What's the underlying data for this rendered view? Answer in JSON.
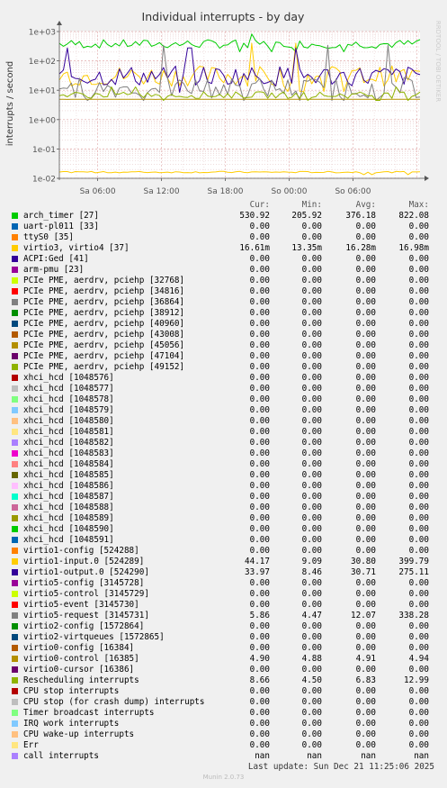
{
  "chart_data": {
    "type": "line",
    "title": "Individual interrupts - by day",
    "ylabel": "interrupts / second",
    "watermark": "RRDTOOL / TOBI OETIKER",
    "yscale": "log",
    "ylim": [
      0.01,
      1000
    ],
    "grid": true,
    "y_ticks": [
      "1e-02",
      "1e-01",
      "1e+00",
      "1e+01",
      "1e+02",
      "1e+03"
    ],
    "x_ticks": [
      "Sa 06:00",
      "Sa 12:00",
      "Sa 18:00",
      "So 00:00",
      "So 06:00"
    ],
    "series": [
      {
        "name": "arch_timer [27]",
        "color": "#00cc00",
        "cur": "530.92",
        "min": "205.92",
        "avg": "376.18",
        "max": "822.08"
      },
      {
        "name": "uart-pl011 [33]",
        "color": "#0066b3",
        "cur": "0.00",
        "min": "0.00",
        "avg": "0.00",
        "max": "0.00"
      },
      {
        "name": "ttyS0 [35]",
        "color": "#ff8000",
        "cur": "0.00",
        "min": "0.00",
        "avg": "0.00",
        "max": "0.00"
      },
      {
        "name": "virtio3, virtio4 [37]",
        "color": "#ffcc00",
        "cur": "16.61m",
        "min": "13.35m",
        "avg": "16.28m",
        "max": "16.98m"
      },
      {
        "name": "ACPI:Ged [41]",
        "color": "#330099",
        "cur": "0.00",
        "min": "0.00",
        "avg": "0.00",
        "max": "0.00"
      },
      {
        "name": "arm-pmu [23]",
        "color": "#990099",
        "cur": "0.00",
        "min": "0.00",
        "avg": "0.00",
        "max": "0.00"
      },
      {
        "name": "PCIe PME, aerdrv, pciehp [32768]",
        "color": "#ccff00",
        "cur": "0.00",
        "min": "0.00",
        "avg": "0.00",
        "max": "0.00"
      },
      {
        "name": "PCIe PME, aerdrv, pciehp [34816]",
        "color": "#ff0000",
        "cur": "0.00",
        "min": "0.00",
        "avg": "0.00",
        "max": "0.00"
      },
      {
        "name": "PCIe PME, aerdrv, pciehp [36864]",
        "color": "#808080",
        "cur": "0.00",
        "min": "0.00",
        "avg": "0.00",
        "max": "0.00"
      },
      {
        "name": "PCIe PME, aerdrv, pciehp [38912]",
        "color": "#008f00",
        "cur": "0.00",
        "min": "0.00",
        "avg": "0.00",
        "max": "0.00"
      },
      {
        "name": "PCIe PME, aerdrv, pciehp [40960]",
        "color": "#00487d",
        "cur": "0.00",
        "min": "0.00",
        "avg": "0.00",
        "max": "0.00"
      },
      {
        "name": "PCIe PME, aerdrv, pciehp [43008]",
        "color": "#b35a00",
        "cur": "0.00",
        "min": "0.00",
        "avg": "0.00",
        "max": "0.00"
      },
      {
        "name": "PCIe PME, aerdrv, pciehp [45056]",
        "color": "#b38f00",
        "cur": "0.00",
        "min": "0.00",
        "avg": "0.00",
        "max": "0.00"
      },
      {
        "name": "PCIe PME, aerdrv, pciehp [47104]",
        "color": "#6b006b",
        "cur": "0.00",
        "min": "0.00",
        "avg": "0.00",
        "max": "0.00"
      },
      {
        "name": "PCIe PME, aerdrv, pciehp [49152]",
        "color": "#8fb300",
        "cur": "0.00",
        "min": "0.00",
        "avg": "0.00",
        "max": "0.00"
      },
      {
        "name": "xhci_hcd [1048576]",
        "color": "#b30000",
        "cur": "0.00",
        "min": "0.00",
        "avg": "0.00",
        "max": "0.00"
      },
      {
        "name": "xhci_hcd [1048577]",
        "color": "#bebebe",
        "cur": "0.00",
        "min": "0.00",
        "avg": "0.00",
        "max": "0.00"
      },
      {
        "name": "xhci_hcd [1048578]",
        "color": "#80ff80",
        "cur": "0.00",
        "min": "0.00",
        "avg": "0.00",
        "max": "0.00"
      },
      {
        "name": "xhci_hcd [1048579]",
        "color": "#80c9ff",
        "cur": "0.00",
        "min": "0.00",
        "avg": "0.00",
        "max": "0.00"
      },
      {
        "name": "xhci_hcd [1048580]",
        "color": "#ffc080",
        "cur": "0.00",
        "min": "0.00",
        "avg": "0.00",
        "max": "0.00"
      },
      {
        "name": "xhci_hcd [1048581]",
        "color": "#ffe680",
        "cur": "0.00",
        "min": "0.00",
        "avg": "0.00",
        "max": "0.00"
      },
      {
        "name": "xhci_hcd [1048582]",
        "color": "#aa80ff",
        "cur": "0.00",
        "min": "0.00",
        "avg": "0.00",
        "max": "0.00"
      },
      {
        "name": "xhci_hcd [1048583]",
        "color": "#ee00cc",
        "cur": "0.00",
        "min": "0.00",
        "avg": "0.00",
        "max": "0.00"
      },
      {
        "name": "xhci_hcd [1048584]",
        "color": "#ff8080",
        "cur": "0.00",
        "min": "0.00",
        "avg": "0.00",
        "max": "0.00"
      },
      {
        "name": "xhci_hcd [1048585]",
        "color": "#666600",
        "cur": "0.00",
        "min": "0.00",
        "avg": "0.00",
        "max": "0.00"
      },
      {
        "name": "xhci_hcd [1048586]",
        "color": "#ffbfff",
        "cur": "0.00",
        "min": "0.00",
        "avg": "0.00",
        "max": "0.00"
      },
      {
        "name": "xhci_hcd [1048587]",
        "color": "#00ffcc",
        "cur": "0.00",
        "min": "0.00",
        "avg": "0.00",
        "max": "0.00"
      },
      {
        "name": "xhci_hcd [1048588]",
        "color": "#cc6699",
        "cur": "0.00",
        "min": "0.00",
        "avg": "0.00",
        "max": "0.00"
      },
      {
        "name": "xhci_hcd [1048589]",
        "color": "#999900",
        "cur": "0.00",
        "min": "0.00",
        "avg": "0.00",
        "max": "0.00"
      },
      {
        "name": "xhci_hcd [1048590]",
        "color": "#00cc00",
        "cur": "0.00",
        "min": "0.00",
        "avg": "0.00",
        "max": "0.00"
      },
      {
        "name": "xhci_hcd [1048591]",
        "color": "#0066b3",
        "cur": "0.00",
        "min": "0.00",
        "avg": "0.00",
        "max": "0.00"
      },
      {
        "name": "virtio1-config [524288]",
        "color": "#ff8000",
        "cur": "0.00",
        "min": "0.00",
        "avg": "0.00",
        "max": "0.00"
      },
      {
        "name": "virtio1-input.0 [524289]",
        "color": "#ffcc00",
        "cur": "44.17",
        "min": "9.09",
        "avg": "30.80",
        "max": "399.79"
      },
      {
        "name": "virtio1-output.0 [524290]",
        "color": "#330099",
        "cur": "33.97",
        "min": "8.46",
        "avg": "30.71",
        "max": "275.11"
      },
      {
        "name": "virtio5-config [3145728]",
        "color": "#990099",
        "cur": "0.00",
        "min": "0.00",
        "avg": "0.00",
        "max": "0.00"
      },
      {
        "name": "virtio5-control [3145729]",
        "color": "#ccff00",
        "cur": "0.00",
        "min": "0.00",
        "avg": "0.00",
        "max": "0.00"
      },
      {
        "name": "virtio5-event [3145730]",
        "color": "#ff0000",
        "cur": "0.00",
        "min": "0.00",
        "avg": "0.00",
        "max": "0.00"
      },
      {
        "name": "virtio5-request [3145731]",
        "color": "#808080",
        "cur": "5.86",
        "min": "4.47",
        "avg": "12.07",
        "max": "338.28"
      },
      {
        "name": "virtio2-config [1572864]",
        "color": "#008f00",
        "cur": "0.00",
        "min": "0.00",
        "avg": "0.00",
        "max": "0.00"
      },
      {
        "name": "virtio2-virtqueues [1572865]",
        "color": "#00487d",
        "cur": "0.00",
        "min": "0.00",
        "avg": "0.00",
        "max": "0.00"
      },
      {
        "name": "virtio0-config [16384]",
        "color": "#b35a00",
        "cur": "0.00",
        "min": "0.00",
        "avg": "0.00",
        "max": "0.00"
      },
      {
        "name": "virtio0-control [16385]",
        "color": "#b38f00",
        "cur": "4.90",
        "min": "4.88",
        "avg": "4.91",
        "max": "4.94"
      },
      {
        "name": "virtio0-cursor [16386]",
        "color": "#6b006b",
        "cur": "0.00",
        "min": "0.00",
        "avg": "0.00",
        "max": "0.00"
      },
      {
        "name": "Rescheduling interrupts",
        "color": "#8fb300",
        "cur": "8.66",
        "min": "4.50",
        "avg": "6.83",
        "max": "12.99"
      },
      {
        "name": "CPU stop interrupts",
        "color": "#b30000",
        "cur": "0.00",
        "min": "0.00",
        "avg": "0.00",
        "max": "0.00"
      },
      {
        "name": "CPU stop (for crash dump) interrupts",
        "color": "#bebebe",
        "cur": "0.00",
        "min": "0.00",
        "avg": "0.00",
        "max": "0.00"
      },
      {
        "name": "Timer broadcast interrupts",
        "color": "#80ff80",
        "cur": "0.00",
        "min": "0.00",
        "avg": "0.00",
        "max": "0.00"
      },
      {
        "name": "IRQ work interrupts",
        "color": "#80c9ff",
        "cur": "0.00",
        "min": "0.00",
        "avg": "0.00",
        "max": "0.00"
      },
      {
        "name": "CPU wake-up interrupts",
        "color": "#ffc080",
        "cur": "0.00",
        "min": "0.00",
        "avg": "0.00",
        "max": "0.00"
      },
      {
        "name": "Err",
        "color": "#ffe680",
        "cur": "0.00",
        "min": "0.00",
        "avg": "0.00",
        "max": "0.00"
      },
      {
        "name": "call interrupts",
        "color": "#aa80ff",
        "cur": "nan",
        "min": "nan",
        "avg": "nan",
        "max": "nan"
      }
    ]
  },
  "legend_headers": {
    "cur": "Cur:",
    "min": "Min:",
    "avg": "Avg:",
    "max": "Max:"
  },
  "last_update": "Last update: Sun Dec 21 11:25:06 2025",
  "footer": "Munin 2.0.73"
}
